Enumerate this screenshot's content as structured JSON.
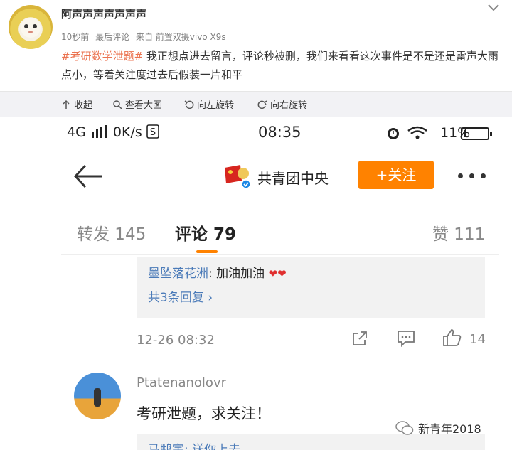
{
  "post": {
    "poster_name": "阿声声声声声声声",
    "time": "10秒前",
    "last_comment": "最后评论",
    "source": "来自 前置双摄vivo X9s",
    "tag": "#考研数学泄题#",
    "text": " 我正想点进去留言，评论秒被删，我们来看看这次事件是不是还是雷声大雨点小，等着关注度过去后假装一片和平"
  },
  "toolbar": {
    "collapse": "收起",
    "view_large": "查看大图",
    "rotate_left": "向左旋转",
    "rotate_right": "向右旋转"
  },
  "phone": {
    "status": {
      "network": "4G",
      "speed": "0K/s",
      "time": "08:35",
      "battery": "11%"
    },
    "nav": {
      "account_name": "共青团中央",
      "follow_label": "+关注"
    },
    "tabs": {
      "repost": "转发 145",
      "comment": "评论 79",
      "like": "赞 111"
    },
    "comment1": {
      "reply_user": "墨坠落花洲",
      "reply_text": ": 加油加油",
      "more_replies": "共3条回复 ›",
      "time": "12-26 08:32",
      "likes": "14"
    },
    "comment2": {
      "user": "Ptatenanolovr",
      "text": "考研泄题，求关注！",
      "reply_preview": "马鹏宇: 送你上去"
    }
  },
  "watermark": "新青年2018",
  "colors": {
    "accent_orange": "#ff8200",
    "link_blue": "#4a7ab8",
    "tag_orange": "#eb7350"
  }
}
